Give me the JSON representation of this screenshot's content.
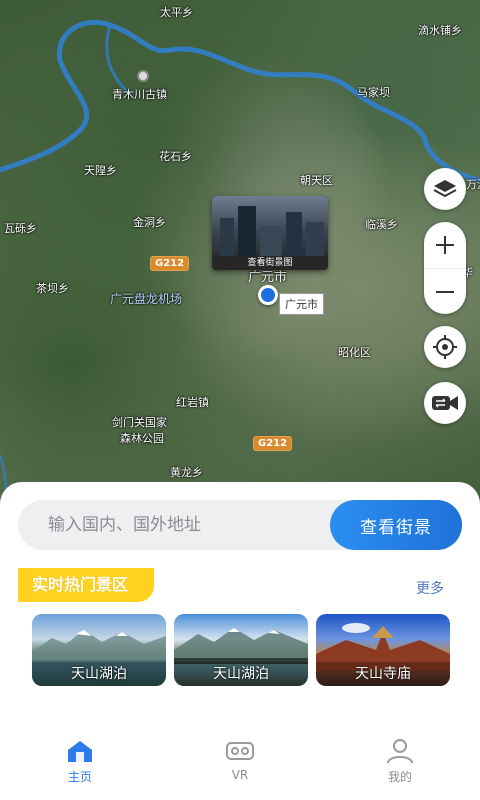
{
  "map": {
    "places": [
      {
        "id": "taipingxiang",
        "text": "太平乡"
      },
      {
        "id": "dishuipuxiang",
        "text": "滴水铺乡"
      },
      {
        "id": "qingmuchuan",
        "text": "青木川古镇"
      },
      {
        "id": "majiaba",
        "text": "马家坝"
      },
      {
        "id": "huashixiang",
        "text": "花石乡"
      },
      {
        "id": "tianhuangxiang",
        "text": "天隍乡"
      },
      {
        "id": "chaotianqu",
        "text": "朝天区"
      },
      {
        "id": "wanyuan",
        "text": "万源"
      },
      {
        "id": "jindongxiang",
        "text": "金洞乡"
      },
      {
        "id": "linxixiang",
        "text": "临溪乡"
      },
      {
        "id": "wajixiang",
        "text": "瓦砾乡"
      },
      {
        "id": "guangyuanshi",
        "text": "广元市"
      },
      {
        "id": "hua",
        "text": "华"
      },
      {
        "id": "chabaxiang",
        "text": "茶坝乡"
      },
      {
        "id": "airport",
        "text": "广元盘龙机场"
      },
      {
        "id": "zhaohuaqu",
        "text": "昭化区"
      },
      {
        "id": "hongyanzhen",
        "text": "红岩镇"
      },
      {
        "id": "jianmen",
        "text": "剑门关国家"
      },
      {
        "id": "jianmen2",
        "text": "森林公园"
      },
      {
        "id": "huanglongxiang",
        "text": "黄龙乡"
      }
    ],
    "highway_labels": [
      "G212",
      "G212"
    ],
    "streetview_preview_label": "查看街景图",
    "location_tag": "广元市"
  },
  "controls": {
    "layers": "layers-icon",
    "zoom_in": "+",
    "zoom_out": "−",
    "locate": "locate-icon",
    "video": "video-icon"
  },
  "search": {
    "placeholder": "输入国内、国外地址",
    "value": "",
    "button": "查看街景"
  },
  "hot": {
    "title": "实时热门景区",
    "more": "更多",
    "cards": [
      {
        "label": "天山湖泊"
      },
      {
        "label": "天山湖泊"
      },
      {
        "label": "天山寺庙"
      }
    ]
  },
  "nav": {
    "items": [
      {
        "label": "主页",
        "icon": "home-icon",
        "active": true
      },
      {
        "label": "VR",
        "icon": "vr-icon",
        "active": false
      },
      {
        "label": "我的",
        "icon": "user-icon",
        "active": false
      }
    ]
  },
  "colors": {
    "accent": "#2b7be8",
    "hot_tag": "#ffd21f",
    "river": "#2f82d8"
  }
}
